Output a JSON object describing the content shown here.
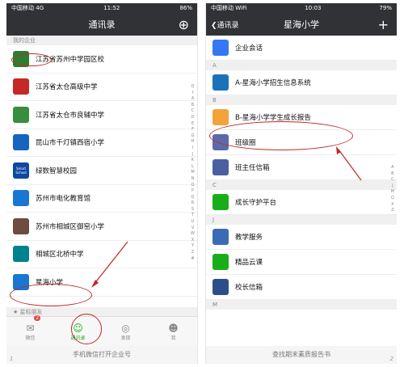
{
  "left": {
    "status": {
      "carrier": "中国移动",
      "network": "4G",
      "time": "11:52",
      "battery": "86%"
    },
    "nav_title": "通讯录",
    "add_icon": "add-person-icon",
    "section_label": "我的企业",
    "items": [
      {
        "name": "江苏省苏州中学园区校",
        "color": "#2e7d32",
        "icon": "school-logo-icon"
      },
      {
        "name": "江苏省太仓高级中学",
        "color": "#c62828",
        "icon": "school-logo-icon"
      },
      {
        "name": "江苏省太仓市良辅中学",
        "color": "#388e3c",
        "icon": "school-logo-icon"
      },
      {
        "name": "昆山市千灯镇西宿小学",
        "color": "#1565c0",
        "icon": "school-logo-icon"
      },
      {
        "name": "绿数智慧校园",
        "color": "#0d47a1",
        "icon": "smart-school-icon",
        "icon_text": "Smart School"
      },
      {
        "name": "苏州市电化教育馆",
        "color": "#1976d2",
        "icon": "school-logo-icon"
      },
      {
        "name": "苏州市相城区御窑小学",
        "color": "#6d4c41",
        "icon": "school-logo-icon"
      },
      {
        "name": "相城区北桥中学",
        "color": "#00838f",
        "icon": "school-logo-icon"
      },
      {
        "name": "星海小学",
        "color": "#1976d2",
        "icon": "school-logo-icon"
      }
    ],
    "starred_label": "星标朋友",
    "index_letters": [
      "Q",
      "↑",
      "A",
      "B",
      "C",
      "D",
      "E",
      "F",
      "G",
      "H",
      "I",
      "J",
      "K",
      "L",
      "M",
      "N",
      "O",
      "P",
      "Q",
      "R",
      "S",
      "T",
      "U",
      "V",
      "W",
      "X",
      "Y",
      "Z",
      "#"
    ],
    "tabs": [
      {
        "label": "微信",
        "icon": "chat-icon",
        "badge": "2"
      },
      {
        "label": "通讯录",
        "icon": "contacts-icon",
        "active": true
      },
      {
        "label": "发现",
        "icon": "compass-icon"
      },
      {
        "label": "我",
        "icon": "person-icon"
      }
    ],
    "caption": "手机微信打开企业号",
    "page_number": "1"
  },
  "right": {
    "status": {
      "carrier": "中国移动",
      "network": "WiFi",
      "time": "10:03",
      "battery": "79%"
    },
    "back_label": "通讯录",
    "nav_title": "星海小学",
    "plus_icon": "plus-icon",
    "top_item": {
      "name": "企业会话",
      "color": "#3478f6",
      "icon": "chat-bubble-icon"
    },
    "sections": [
      {
        "letter": "A",
        "items": [
          {
            "name": "A-星海小学招生信息系统",
            "color": "#1a73b8",
            "icon": "app-logo-icon"
          }
        ]
      },
      {
        "letter": "B",
        "items": [
          {
            "name": "B-星海小学学生成长报告",
            "color": "#f2a33a",
            "icon": "report-icon"
          },
          {
            "name": "班级圈",
            "color": "#5b6aa8",
            "icon": "photo-icon"
          },
          {
            "name": "班主任信箱",
            "color": "#4a5fa0",
            "icon": "mailbox-icon"
          }
        ]
      },
      {
        "letter": "C",
        "items": [
          {
            "name": "成长守护平台",
            "color": "#1aad19",
            "icon": "shield-icon"
          }
        ]
      },
      {
        "letter": "J",
        "items": [
          {
            "name": "教学服务",
            "color": "#3b6bb5",
            "icon": "book-icon"
          },
          {
            "name": "精品云课",
            "color": "#1aad19",
            "icon": "cloud-icon"
          },
          {
            "name": "校长信箱",
            "color": "#2d4c8a",
            "icon": "mail-icon"
          }
        ]
      },
      {
        "letter": "M",
        "items": []
      }
    ],
    "index_letters": [
      "A",
      "B",
      "C",
      "J",
      "M",
      "Q",
      "X",
      "Z"
    ],
    "caption": "查找期末素质报告书",
    "page_number": "2"
  }
}
